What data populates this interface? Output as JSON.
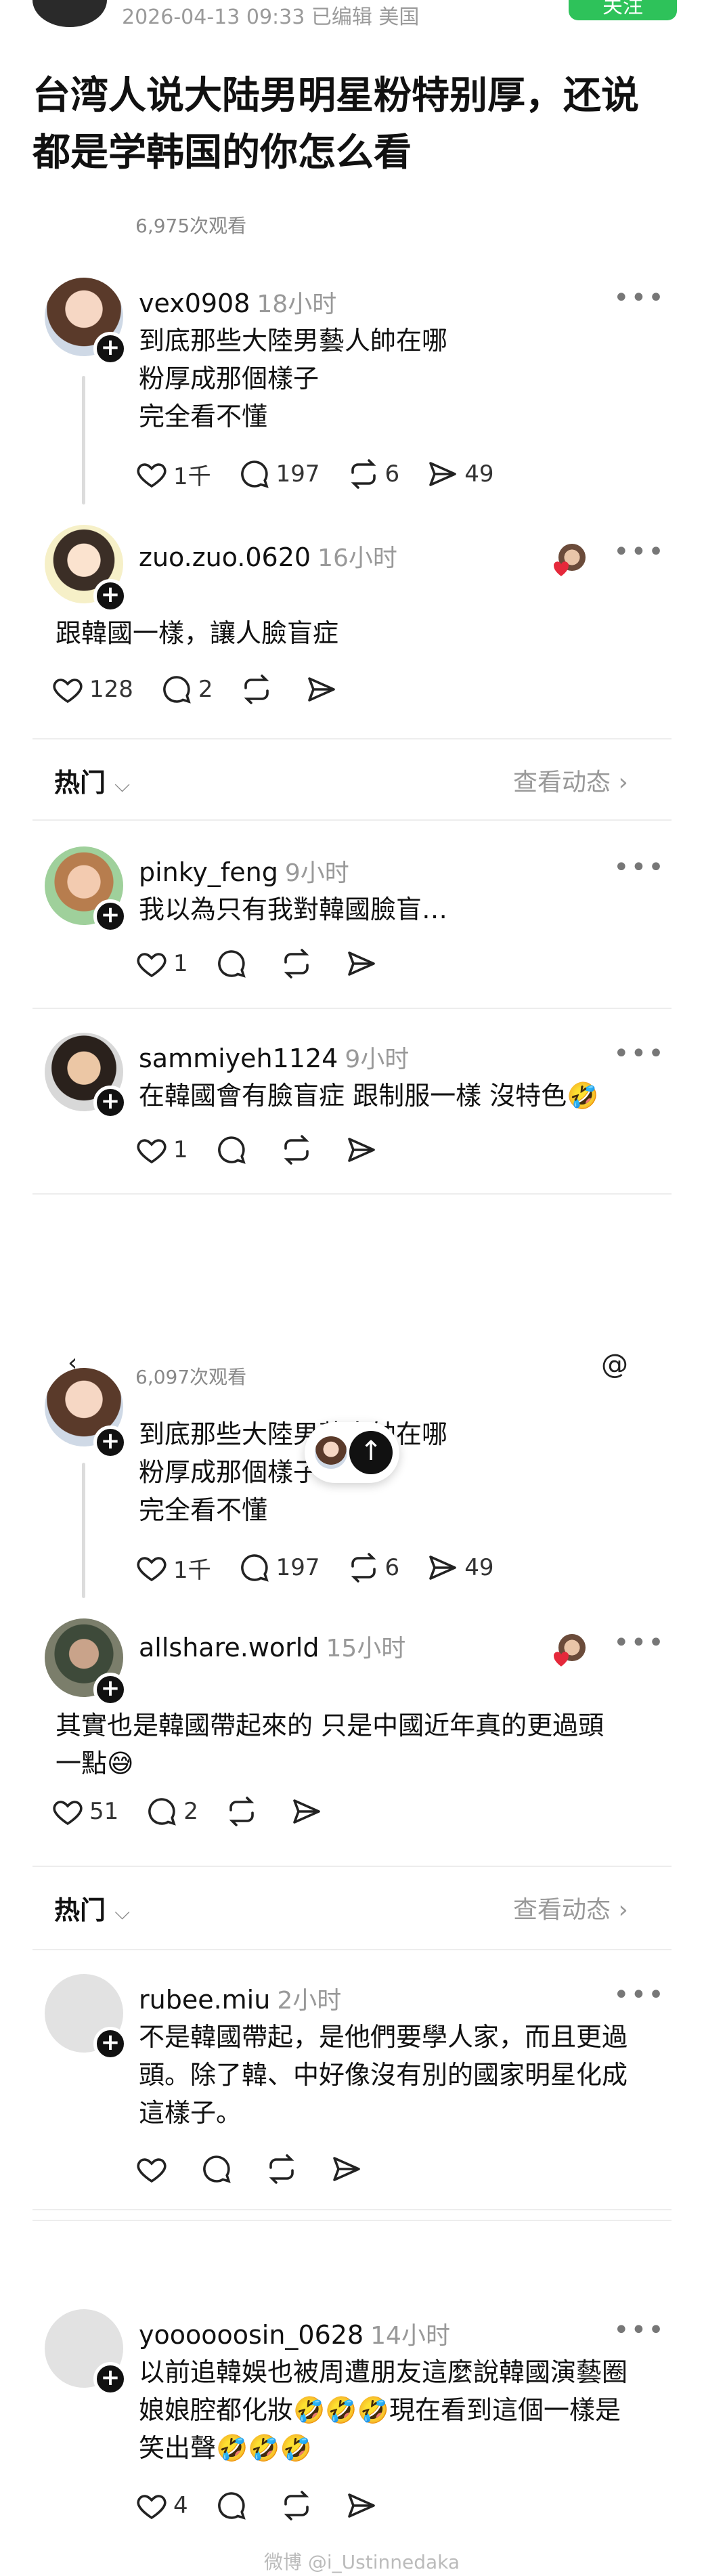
{
  "header": {
    "meta": "2026-04-13 09:33  已编辑  美国",
    "follow_label": "关注"
  },
  "post": {
    "title": "台湾人说大陆男明星粉特别厚，还说都是学韩国的你怎么看"
  },
  "panel1": {
    "views": "6,975次观看",
    "comments": [
      {
        "user": "vex0908",
        "time": "18小时",
        "text_lines": [
          "到底那些大陸男藝人帥在哪",
          "粉厚成那個樣子",
          "完全看不懂"
        ],
        "likes": "1千",
        "replies": "197",
        "reposts": "6",
        "shares": "49"
      },
      {
        "user": "zuo.zuo.0620",
        "time": "16小时",
        "text_lines": [
          "跟韓國一樣，讓人臉盲症"
        ],
        "likes": "128",
        "replies": "2",
        "reposts": "",
        "shares": ""
      }
    ],
    "sort": {
      "label": "热门",
      "view_activity": "查看动态"
    },
    "replies": [
      {
        "user": "pinky_feng",
        "time": "9小时",
        "text": "我以為只有我對韓國臉盲…",
        "likes": "1"
      },
      {
        "user": "sammiyeh1124",
        "time": "9小时",
        "text": "在韓國會有臉盲症 跟制服一樣 沒特色🤣",
        "likes": "1"
      }
    ]
  },
  "panel2": {
    "views": "6,097次观看",
    "comments": [
      {
        "user": "vex0908",
        "text_lines": [
          "到底那些大陸男藝人帥在哪",
          "粉厚成那個樣子",
          "完全看不懂"
        ],
        "likes": "1千",
        "replies": "197",
        "reposts": "6",
        "shares": "49"
      },
      {
        "user": "allshare.world",
        "time": "15小时",
        "text_lines": [
          "其實也是韓國帶起來的 只是中國近年真的更過頭",
          "一點😅"
        ],
        "likes": "51",
        "replies": "2"
      }
    ],
    "sort": {
      "label": "热门",
      "view_activity": "查看动态"
    },
    "replies": [
      {
        "user": "rubee.miu",
        "time": "2小时",
        "text_lines": [
          "不是韓國帶起，是他們要學人家，而且更過",
          "頭。除了韓、中好像沒有別的國家明星化成",
          "這樣子。"
        ]
      },
      {
        "user": "yoooooosin_0628",
        "time": "14小时",
        "text_lines": [
          "以前追韓娛也被周遭朋友這麼說韓國演藝圈",
          "娘娘腔都化妝🤣🤣🤣現在看到這個一樣是",
          "笑出聲🤣🤣🤣"
        ],
        "likes": "4"
      }
    ]
  },
  "watermark": "微博 @i_Ustinnedaka",
  "icons": {
    "heart": "heart-icon",
    "reply": "comment-bubble-icon",
    "repost": "repost-icon",
    "share": "send-icon",
    "more": "more-dots-icon",
    "plus": "plus-icon",
    "chevron": "chevron-right-icon",
    "up": "arrow-up-icon"
  },
  "colors": {
    "follow": "#2ec25a",
    "meta": "#9a9a9a",
    "divider": "#ededed",
    "heart_red": "#e5293b"
  }
}
